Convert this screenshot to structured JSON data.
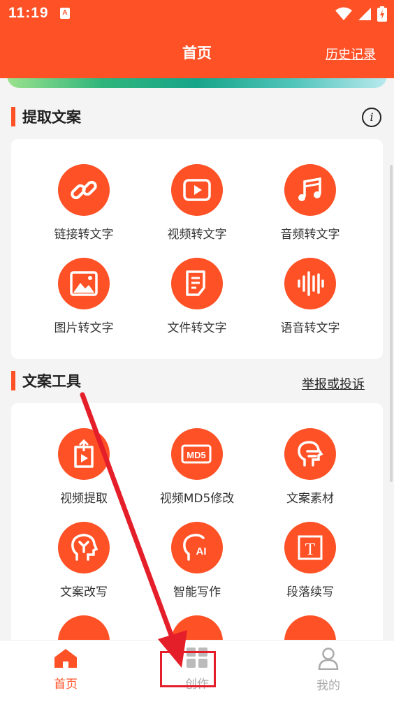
{
  "status_bar": {
    "time": "11:19",
    "notification_icon": "A"
  },
  "header": {
    "title": "首页",
    "history_link": "历史记录"
  },
  "extract_section": {
    "title": "提取文案",
    "items": [
      {
        "label": "链接转文字",
        "icon": "link-icon"
      },
      {
        "label": "视频转文字",
        "icon": "video-play-icon"
      },
      {
        "label": "音频转文字",
        "icon": "music-note-icon"
      },
      {
        "label": "图片转文字",
        "icon": "image-icon"
      },
      {
        "label": "文件转文字",
        "icon": "document-icon"
      },
      {
        "label": "语音转文字",
        "icon": "sound-wave-icon"
      }
    ]
  },
  "tools_section": {
    "title": "文案工具",
    "report_link": "举报或投诉",
    "items": [
      {
        "label": "视频提取",
        "icon": "video-export-icon"
      },
      {
        "label": "视频MD5修改",
        "icon": "md5-icon",
        "badge_text": "MD5"
      },
      {
        "label": "文案素材",
        "icon": "head-sound-icon"
      },
      {
        "label": "文案改写",
        "icon": "head-y-icon"
      },
      {
        "label": "智能写作",
        "icon": "head-ai-icon",
        "badge_text": "AI"
      },
      {
        "label": "段落续写",
        "icon": "text-t-icon",
        "badge_text": "T"
      }
    ]
  },
  "tab_bar": {
    "tabs": [
      {
        "label": "首页",
        "icon": "home-icon",
        "active": true
      },
      {
        "label": "创作",
        "icon": "grid-icon",
        "active": false
      },
      {
        "label": "我的",
        "icon": "user-icon",
        "active": false
      }
    ]
  },
  "colors": {
    "accent": "#ff5126",
    "annotation": "#e51f2a",
    "inactive": "#aaaaaa"
  }
}
